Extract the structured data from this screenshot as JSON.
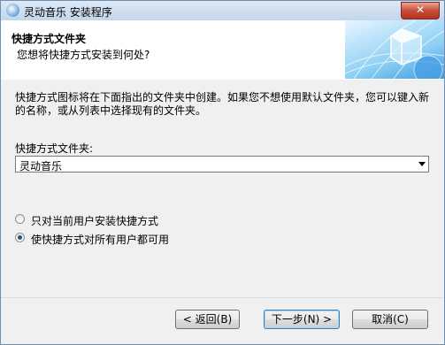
{
  "window": {
    "title": "灵动音乐 安装程序",
    "close_label": "✕"
  },
  "header": {
    "title": "快捷方式文件夹",
    "subtitle": "您想将快捷方式安装到何处?"
  },
  "description": "快捷方式图标将在下面指出的文件夹中创建。如果您不想使用默认文件夹，您可以键入新的名称，或从列表中选择现有的文件夹。",
  "folder": {
    "label": "快捷方式文件夹:",
    "value": "灵动音乐"
  },
  "options": [
    {
      "label": "只对当前用户安装快捷方式",
      "selected": false
    },
    {
      "label": "使快捷方式对所有用户都可用",
      "selected": true
    }
  ],
  "buttons": {
    "back": "< 返回(B)",
    "next": "下一步(N) >",
    "cancel": "取消(C)"
  }
}
